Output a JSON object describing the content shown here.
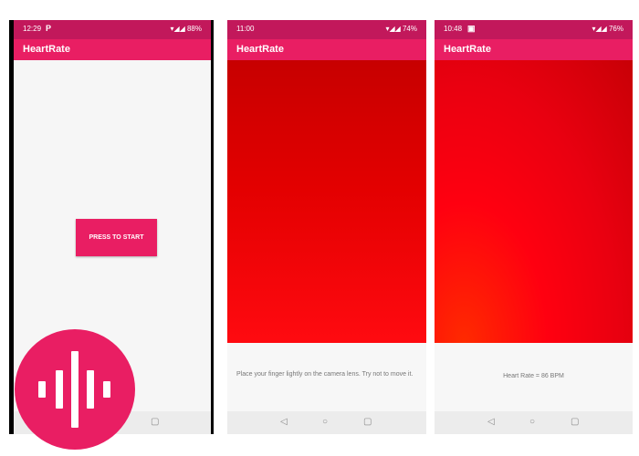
{
  "app_title": "HeartRate",
  "screens": [
    {
      "status_time": "12:29",
      "status_left_icon": "P",
      "status_right": "88%",
      "start_button_label": "PRESS TO START"
    },
    {
      "status_time": "11:00",
      "status_right": "74%",
      "instruction": "Place your finger lightly on the camera lens. Try not to move it."
    },
    {
      "status_time": "10:48",
      "status_right": "76%",
      "heart_rate_text": "Heart Rate = 86 BPM"
    }
  ],
  "navbar_icons": [
    "back-icon",
    "home-icon",
    "recents-icon"
  ],
  "logo_icon": "audio-wave-icon",
  "colors": {
    "primary": "#e91e63",
    "primary_dark": "#c2185b",
    "camera_red": "#ff0000"
  }
}
